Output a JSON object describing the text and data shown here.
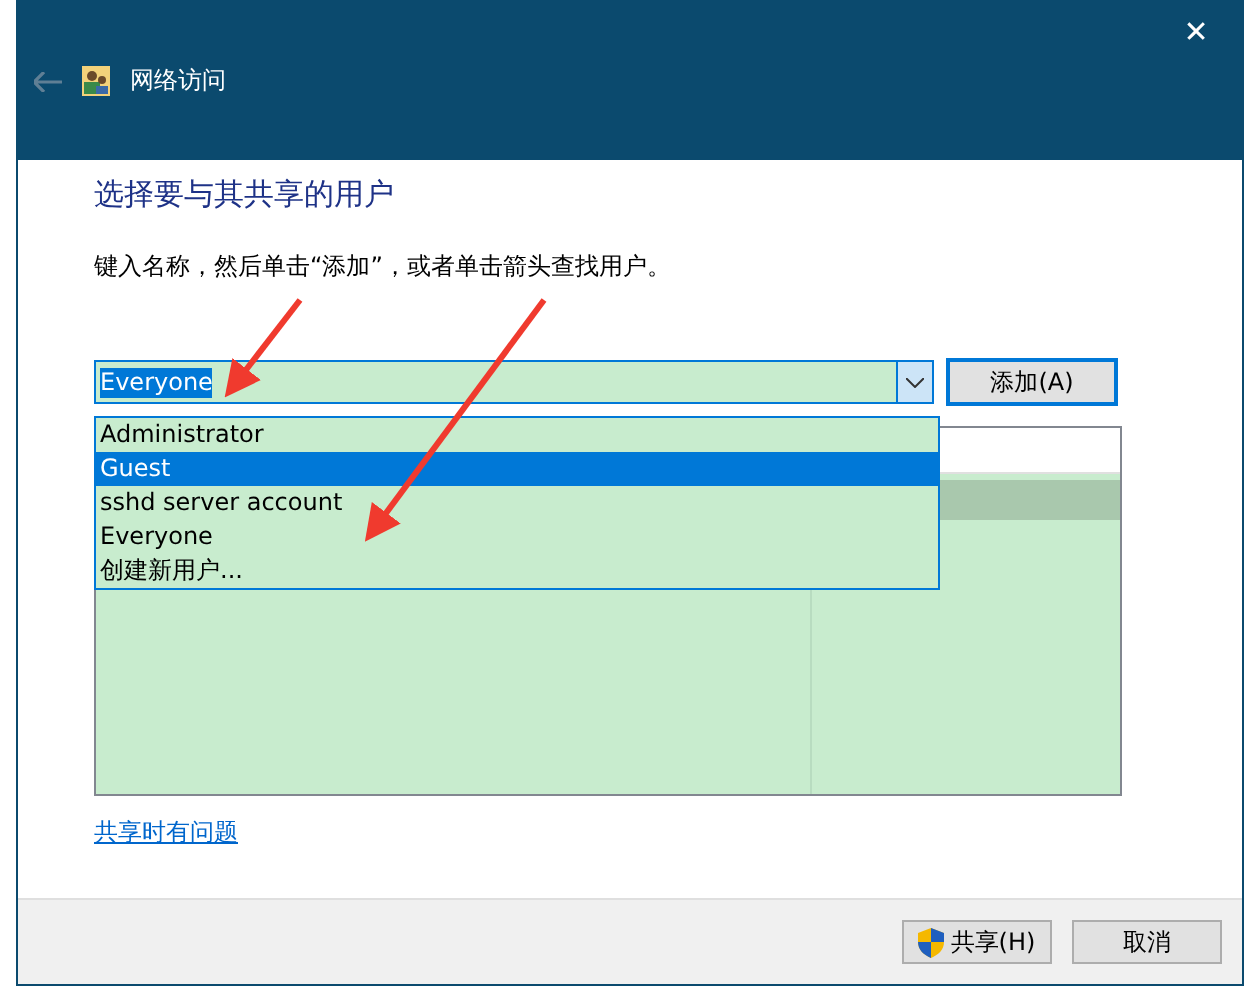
{
  "window": {
    "title": "网络访问",
    "close": "✕"
  },
  "heading": "选择要与其共享的用户",
  "instruction": "键入名称，然后单击“添加”，或者单击箭头查找用户。",
  "combo": {
    "value": "Everyone",
    "add_button": "添加(A)",
    "expanded": true
  },
  "dropdown": [
    {
      "label": "Administrator",
      "selected": false
    },
    {
      "label": "Guest",
      "selected": true
    },
    {
      "label": "sshd server account",
      "selected": false
    },
    {
      "label": "Everyone",
      "selected": false
    },
    {
      "label": "创建新用户...",
      "selected": false
    }
  ],
  "help_link": "共享时有问题",
  "buttons": [
    {
      "label": "共享(H)",
      "kind": "shield"
    },
    {
      "label": "取消",
      "kind": "plain"
    }
  ]
}
